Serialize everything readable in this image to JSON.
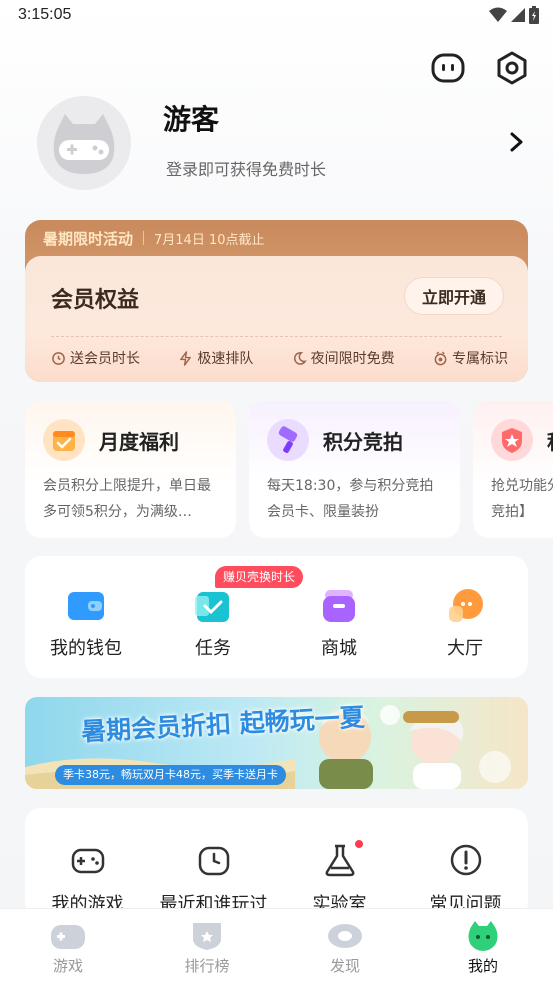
{
  "status_bar": {
    "time": "3:15:05"
  },
  "profile": {
    "name": "游客",
    "hint": "登录即可获得免费时长"
  },
  "vip": {
    "banner_title": "暑期限时活动",
    "banner_deadline": "7月14日 10点截止",
    "title": "会员权益",
    "button": "立即开通",
    "perks": [
      "送会员时长",
      "极速排队",
      "夜间限时免费",
      "专属标识"
    ]
  },
  "features": [
    {
      "title": "月度福利",
      "desc": "会员积分上限提升，单日最多可领5积分，为满级…"
    },
    {
      "title": "积分竞拍",
      "desc": "每天18:30，参与积分竞拍会员卡、限量装扮"
    },
    {
      "title": "积",
      "desc": "抢兑功能分竞拍】"
    }
  ],
  "quick": {
    "badge": "赚贝壳换时长",
    "items": [
      "我的钱包",
      "任务",
      "商城",
      "大厅"
    ]
  },
  "promo": {
    "title": "暑期会员折扣 起畅玩一夏",
    "subtitle": "季卡38元，畅玩双月卡48元，买季卡送月卡"
  },
  "tools": [
    "我的游戏",
    "最近和谁玩过",
    "实验室",
    "常见问题"
  ],
  "nav": [
    "游戏",
    "排行榜",
    "发现",
    "我的"
  ],
  "colors": {
    "accent": "#2fd07a",
    "badge": "#ff4d5e",
    "vip": "#c98a5d"
  }
}
